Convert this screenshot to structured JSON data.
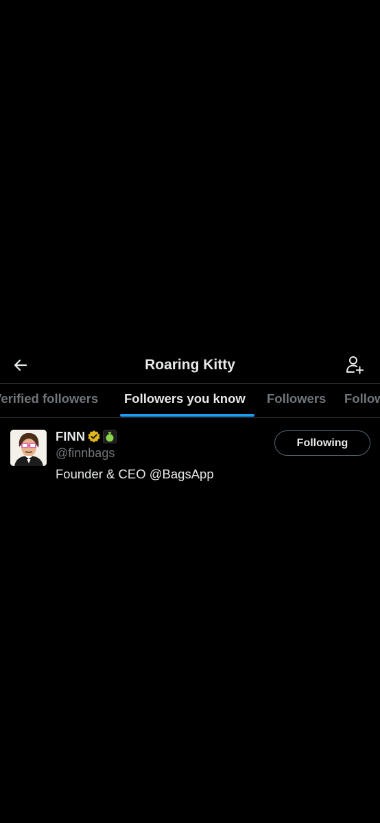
{
  "header": {
    "title": "Roaring Kitty",
    "back_icon": "arrow-left-icon",
    "action_icon": "add-user-icon"
  },
  "tabs": [
    {
      "label": "Verified followers",
      "active": false
    },
    {
      "label": "Followers you know",
      "active": true
    },
    {
      "label": "Followers",
      "active": false
    },
    {
      "label": "Following",
      "active": false
    }
  ],
  "colors": {
    "background": "#000000",
    "accent": "#1d9bf0",
    "primary_text": "#e7e9ea",
    "secondary_text": "#71767b",
    "verified_gold": "#e2b719",
    "affiliate_badge_green": "#8bd450"
  },
  "users": [
    {
      "display_name": "FINN",
      "handle": "@finnbags",
      "bio": "Founder & CEO @BagsApp",
      "verified_badge": "gold-check-icon",
      "affiliate_badge": "money-bag-icon",
      "follow_label": "Following"
    }
  ]
}
